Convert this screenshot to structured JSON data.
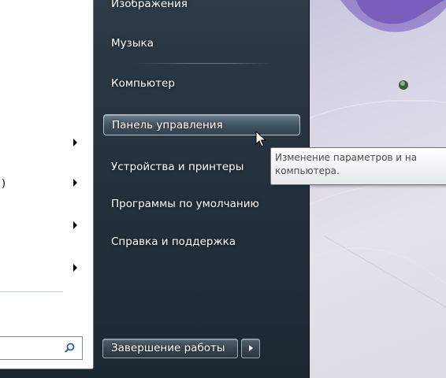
{
  "start_menu": {
    "right_items": [
      {
        "label": "Изображения",
        "partial": true
      },
      {
        "label": "Музыка"
      },
      {
        "label": "Компьютер"
      },
      {
        "label": "Панель управления",
        "highlighted": true
      },
      {
        "label": "Устройства и принтеры"
      },
      {
        "label": "Программы по умолчанию"
      },
      {
        "label": "Справка и поддержка"
      }
    ],
    "left_fragment": ")",
    "shutdown_label": "Завершение работы"
  },
  "tooltip": {
    "line1": "Изменение параметров и на",
    "line2": "компьютера."
  },
  "icons": {
    "search": "search-icon",
    "submenu_arrow": "chevron-right-icon",
    "cursor": "mouse-pointer-icon"
  },
  "colors": {
    "menu_bg": "#24313c",
    "left_pane": "#ffffff",
    "text": "#ffffff",
    "tooltip_text": "#4c4c4c"
  }
}
